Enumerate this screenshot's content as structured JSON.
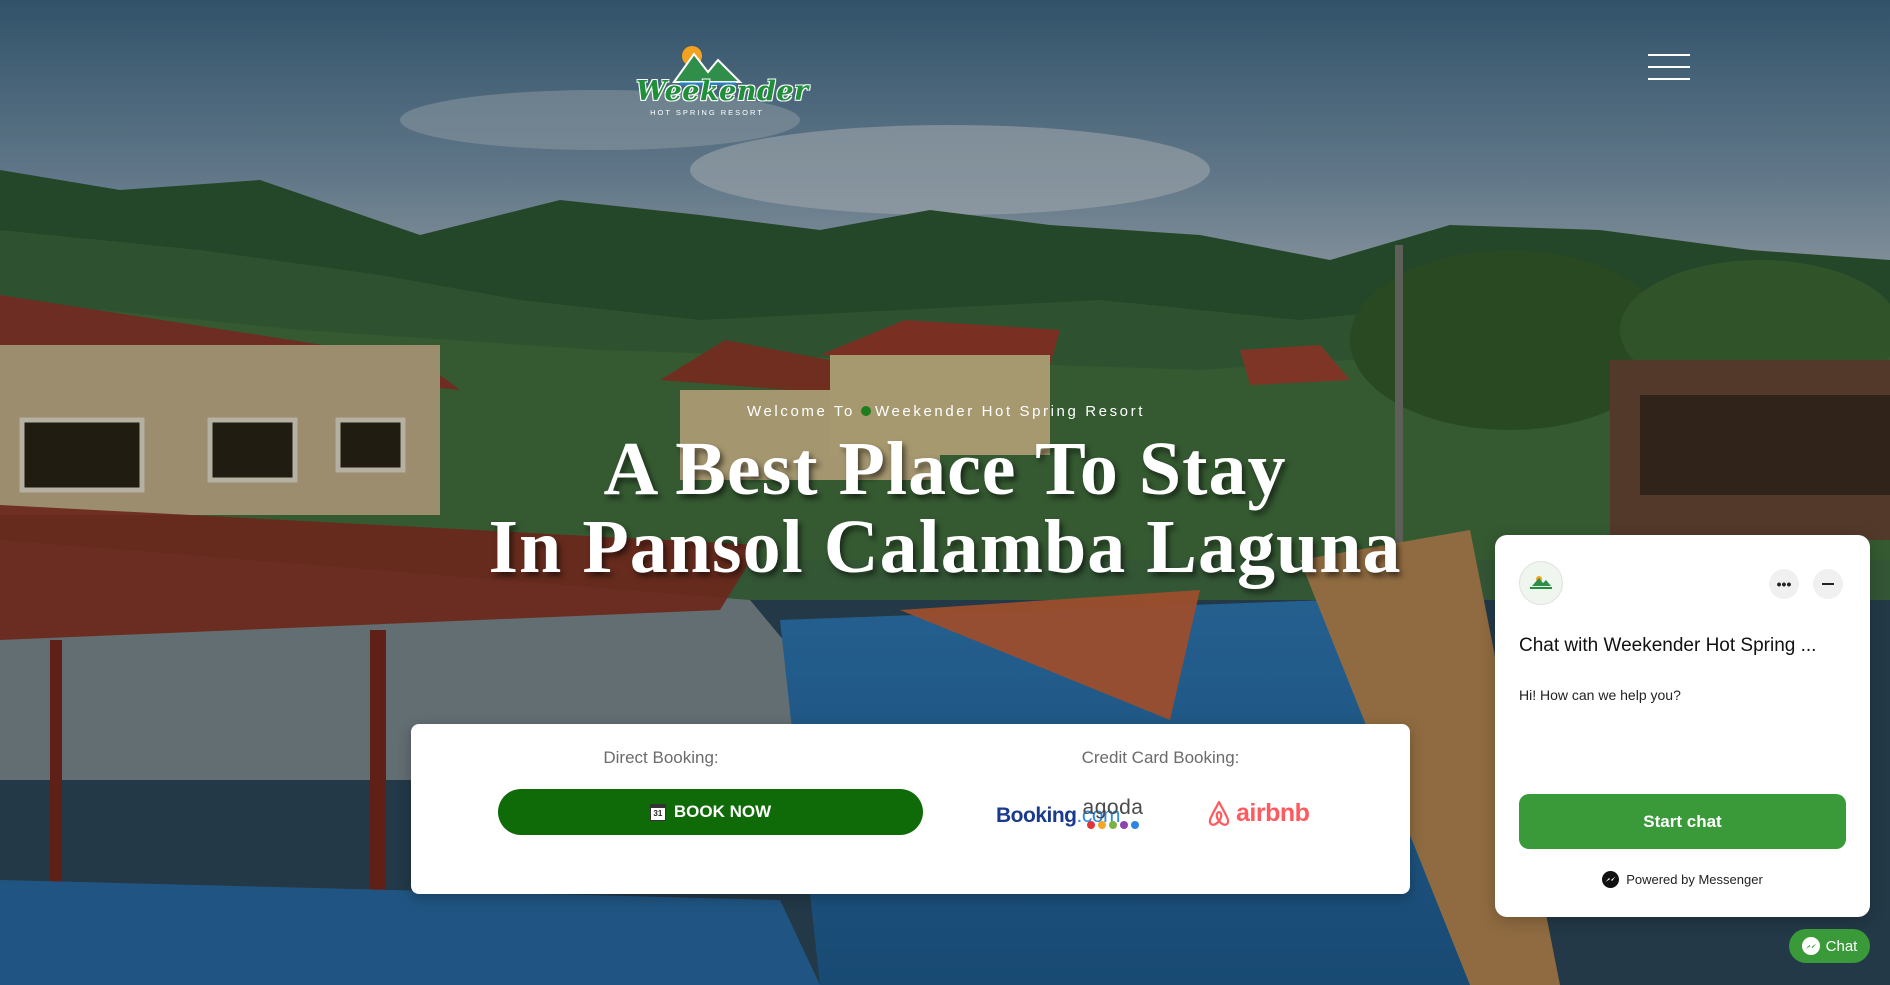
{
  "header": {
    "logo_word": "Weekender",
    "logo_sub": "HOT SPRING RESORT"
  },
  "hero": {
    "welcome_prefix": "Welcome To",
    "welcome_name": "Weekender Hot Spring Resort",
    "headline_line1": "A Best Place To Stay",
    "headline_line2": "In Pansol Calamba Laguna"
  },
  "booking": {
    "direct_label": "Direct Booking:",
    "book_now_label": "BOOK NOW",
    "calendar_day": "31",
    "credit_label": "Credit Card Booking:",
    "partners": {
      "booking_main": "Booking",
      "booking_tld": ".com",
      "agoda": "agoda",
      "airbnb": "airbnb"
    }
  },
  "chat": {
    "title": "Chat with Weekender Hot Spring ...",
    "message": "Hi! How can we help you?",
    "start_label": "Start chat",
    "powered_label": "Powered by Messenger",
    "more_label": "•••",
    "bubble_label": "Chat"
  },
  "colors": {
    "brand_green": "#0e6b08",
    "messenger_green": "#3a9a3a",
    "airbnb_red": "#ff5a5f",
    "booking_blue": "#1a3a8f"
  }
}
